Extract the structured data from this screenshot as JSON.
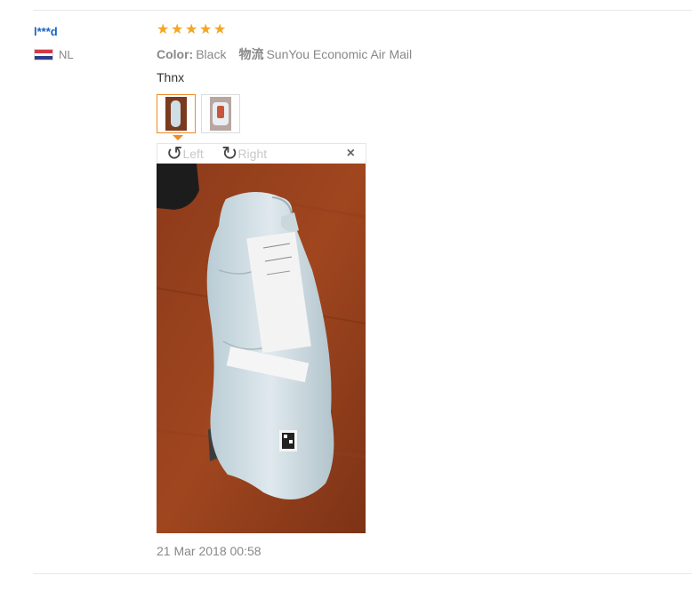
{
  "review": {
    "user": {
      "name": "l***d",
      "country_code": "NL",
      "flag_icon": "netherlands-flag-icon"
    },
    "rating": {
      "stars": 5,
      "max": 5,
      "color": "#f5a623"
    },
    "meta": {
      "color_label": "Color:",
      "color_value": "Black",
      "shipping_label": "物流",
      "shipping_value": "SunYou Economic Air Mail"
    },
    "text": "Thnx",
    "images": [
      {
        "name": "photo-1",
        "active": true
      },
      {
        "name": "photo-2",
        "active": false
      }
    ],
    "viewer": {
      "rotate_left_label": "Left",
      "rotate_right_label": "Right",
      "close_glyph": "×"
    },
    "date": "21 Mar 2018 00:58"
  },
  "colors": {
    "username": "#1b63bf",
    "accent": "#f08a24"
  }
}
